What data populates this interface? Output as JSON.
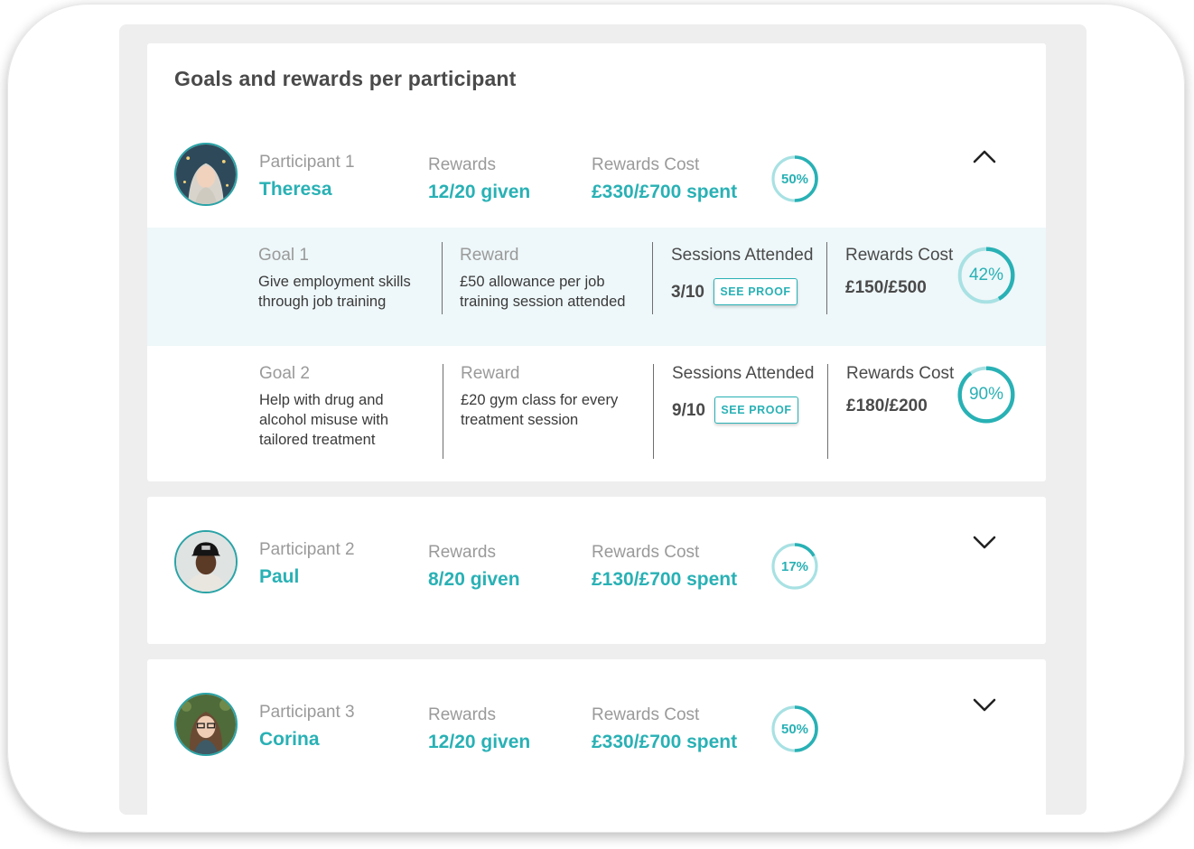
{
  "title": "Goals and rewards per participant",
  "colors": {
    "accent": "#29b1b5",
    "ring_track": "#a8e1e3",
    "row_highlight": "#eef7f9"
  },
  "labels": {
    "rewards": "Rewards",
    "rewards_cost": "Rewards Cost"
  },
  "participants": [
    {
      "label": "Participant 1",
      "name": "Theresa",
      "rewards": "12/20 given",
      "cost": "£330/£700 spent",
      "percent_label": "50%",
      "percent": 50,
      "expanded": true,
      "toggle_icon": "chevron-up-icon",
      "goals": [
        {
          "goal_label": "Goal 1",
          "goal_text": "Give employment skills through job training",
          "reward_label": "Reward",
          "reward_text": "£50 allowance per job training session attended",
          "sessions_label": "Sessions Attended",
          "sessions": "3/10",
          "proof_button": "SEE PROOF",
          "cost_label": "Rewards Cost",
          "cost": "£150/£500",
          "percent_label": "42%",
          "percent": 42
        },
        {
          "goal_label": "Goal 2",
          "goal_text": "Help with drug and alcohol misuse with tailored treatment",
          "reward_label": "Reward",
          "reward_text": "£20 gym class for every treatment session",
          "sessions_label": "Sessions Attended",
          "sessions": "9/10",
          "proof_button": "SEE PROOF",
          "cost_label": "Rewards Cost",
          "cost": "£180/£200",
          "percent_label": "90%",
          "percent": 90
        }
      ]
    },
    {
      "label": "Participant 2",
      "name": "Paul",
      "rewards": "8/20 given",
      "cost": "£130/£700 spent",
      "percent_label": "17%",
      "percent": 17,
      "expanded": false,
      "toggle_icon": "chevron-down-icon"
    },
    {
      "label": "Participant 3",
      "name": "Corina",
      "rewards": "12/20 given",
      "cost": "£330/£700 spent",
      "percent_label": "50%",
      "percent": 50,
      "expanded": false,
      "toggle_icon": "chevron-down-icon"
    }
  ]
}
